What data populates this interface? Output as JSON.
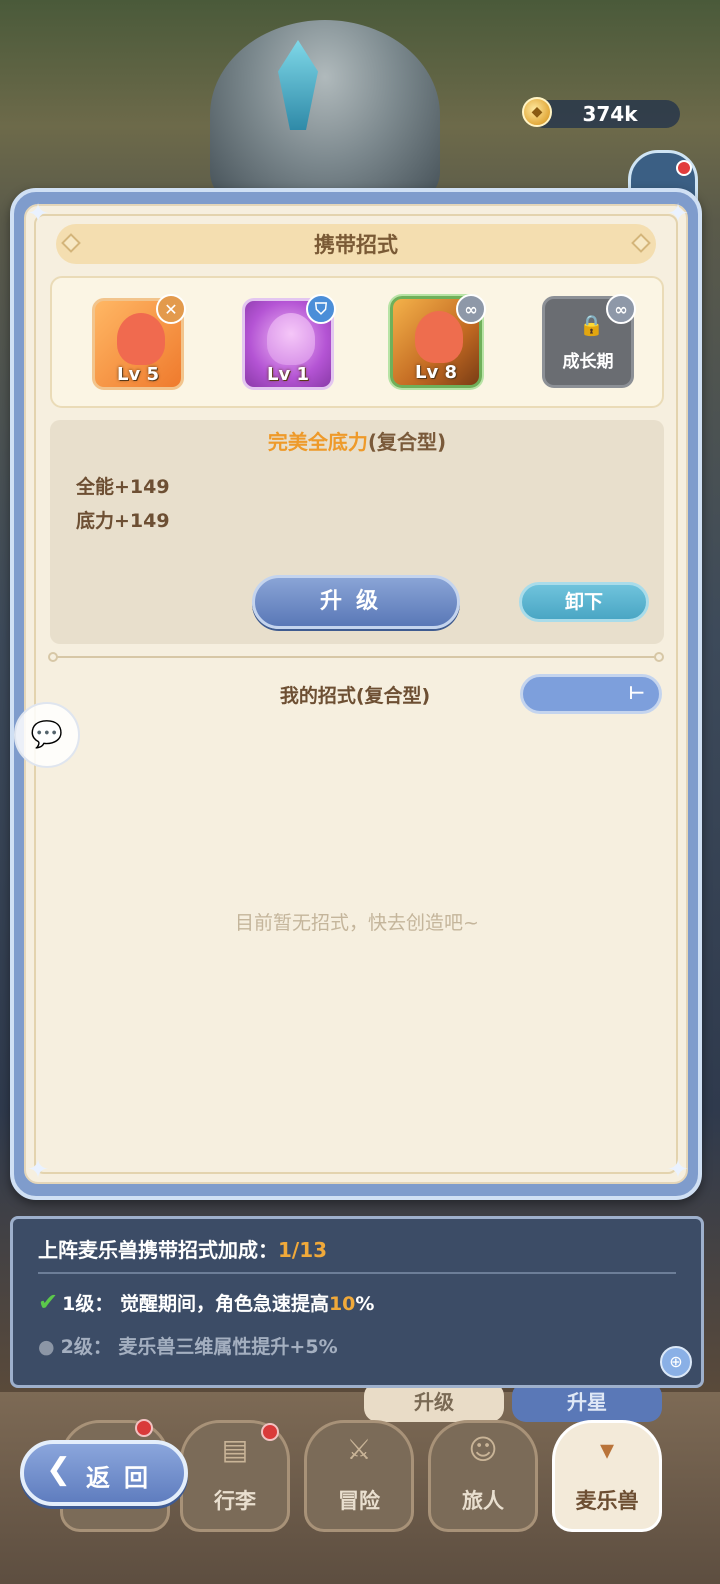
{
  "currency": {
    "icon": "gem-coin-icon",
    "value": "374k"
  },
  "panel": {
    "title": "携带招式",
    "slots": [
      {
        "level": "Lv 5",
        "badge": "close-icon"
      },
      {
        "level": "Lv 1",
        "badge": "shield-icon"
      },
      {
        "level": "Lv 8",
        "badge": "link-icon"
      },
      {
        "label": "成长期",
        "badge": "link-icon",
        "locked": true
      }
    ],
    "selected_skill": {
      "name": "完美全底力",
      "type": "(复合型)",
      "stats": [
        "全能+149",
        "底力+149"
      ]
    },
    "upgrade_label": "升级",
    "unequip_label": "卸下",
    "my_skills_label": "我的招式(复合型)",
    "filter_value": "",
    "empty_message": "目前暂无招式，快去创造吧~"
  },
  "bonus": {
    "title": "上阵麦乐兽携带招式加成：",
    "count": "1/13",
    "rows": [
      {
        "prefix": "1级：  觉醒期间，角色急速提高",
        "pct": "10",
        "suffix": "%",
        "unlocked": true
      },
      {
        "text": "2级：  麦乐兽三维属性提升+5%",
        "unlocked": false
      }
    ]
  },
  "tabs_partial": [
    "升级",
    "升星"
  ],
  "nav": {
    "back_label": "返回",
    "items": [
      "行李",
      "冒险",
      "旅人",
      "麦乐兽"
    ],
    "active": "麦乐兽"
  },
  "colors": {
    "accent_orange": "#ee9a2a",
    "panel_blue": "#7f9ccc",
    "parchment": "#f6efdf",
    "bonus_bg": "#3c4c66",
    "check_green": "#5bc84b"
  }
}
